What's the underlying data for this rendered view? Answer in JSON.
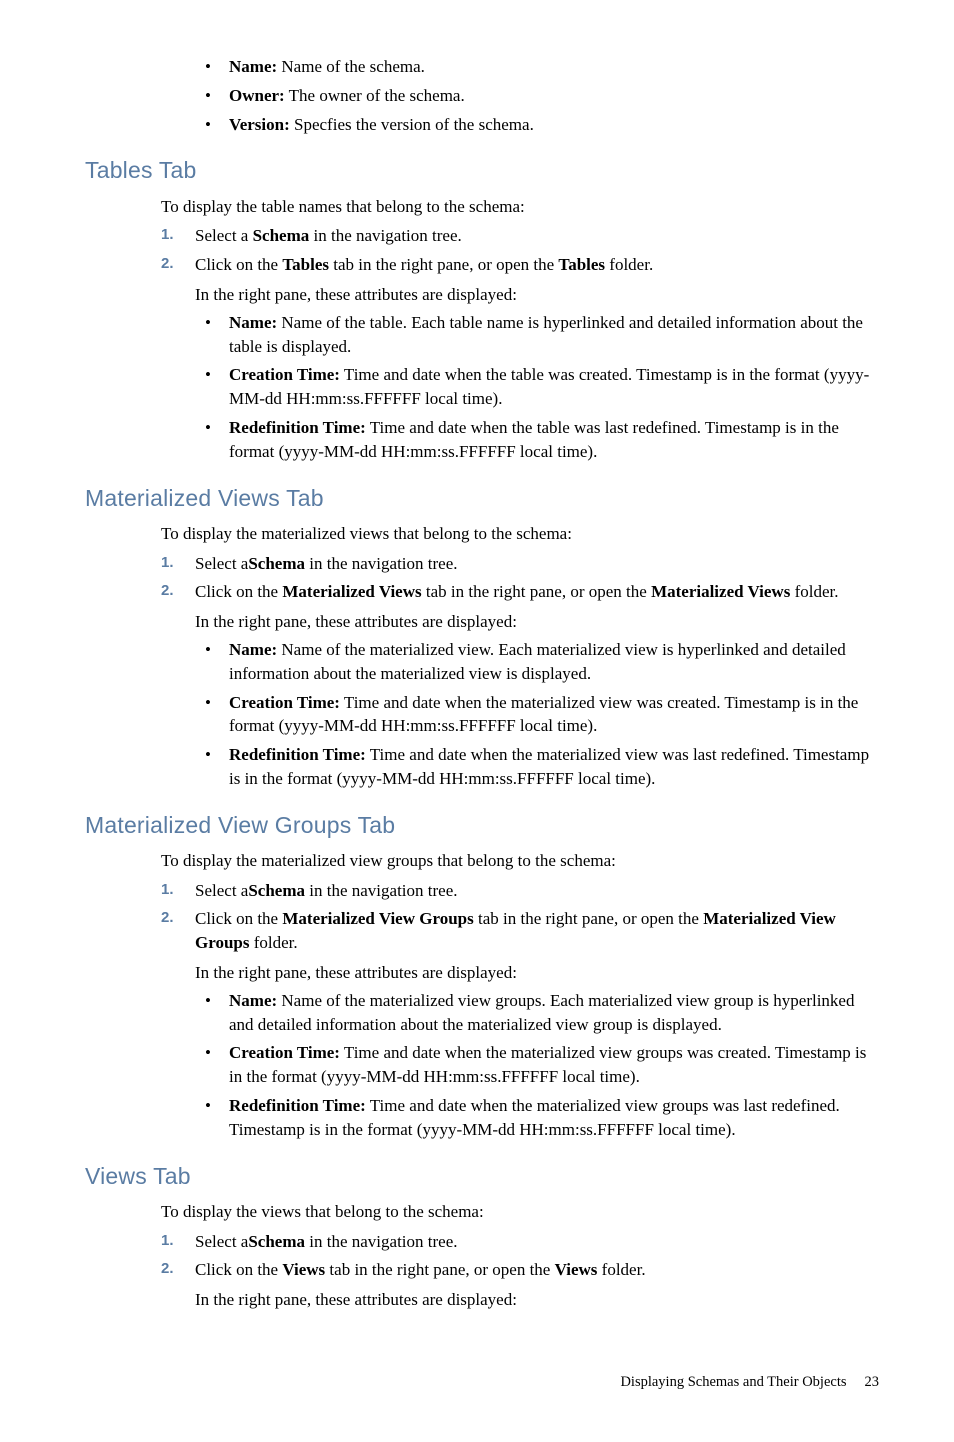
{
  "intro_bullets": [
    {
      "term": "Name:",
      "desc": " Name of the schema."
    },
    {
      "term": "Owner:",
      "desc": " The owner of the schema."
    },
    {
      "term": "Version:",
      "desc": " Specfies the version of the schema."
    }
  ],
  "sections": {
    "tables": {
      "heading": "Tables Tab",
      "intro": "To display the table names that belong to the schema:",
      "step1_pre": "Select a ",
      "step1_b": "Schema",
      "step1_post": " in the navigation tree.",
      "step2_pre": "Click on the ",
      "step2_b1": "Tables",
      "step2_mid": " tab in the right pane, or open the ",
      "step2_b2": "Tables",
      "step2_post": " folder.",
      "attrline": "In the right pane, these attributes are displayed:",
      "attrs": [
        {
          "term": "Name:",
          "desc": " Name of the table. Each table name is hyperlinked and detailed information about the table is displayed."
        },
        {
          "term": "Creation Time:",
          "desc": " Time and date when the table was created. Timestamp is in the format (yyyy-MM-dd HH:mm:ss.FFFFFF local time)."
        },
        {
          "term": "Redefinition Time:",
          "desc": " Time and date when the table was last redefined. Timestamp is in the format (yyyy-MM-dd HH:mm:ss.FFFFFF local time)."
        }
      ]
    },
    "mviews": {
      "heading": "Materialized Views Tab",
      "intro": "To display the materialized views that belong to the schema:",
      "step1_pre": "Select a",
      "step1_b": "Schema",
      "step1_post": " in the navigation tree.",
      "step2_pre": "Click on the ",
      "step2_b1": "Materialized Views",
      "step2_mid": " tab in the right pane, or open the ",
      "step2_b2": "Materialized Views",
      "step2_post": " folder.",
      "attrline": "In the right pane, these attributes are displayed:",
      "attrs": [
        {
          "term": "Name:",
          "desc": " Name of the materialized view. Each materialized view is hyperlinked and detailed information about the materialized view is displayed."
        },
        {
          "term": "Creation Time:",
          "desc": " Time and date when the materialized view was created. Timestamp is in the format (yyyy-MM-dd HH:mm:ss.FFFFFF local time)."
        },
        {
          "term": "Redefinition Time:",
          "desc": " Time and date when the materialized view was last redefined. Timestamp is in the format (yyyy-MM-dd HH:mm:ss.FFFFFF local time)."
        }
      ]
    },
    "mvgroups": {
      "heading": "Materialized View Groups Tab",
      "intro": "To display the materialized view groups that belong to the schema:",
      "step1_pre": "Select a",
      "step1_b": "Schema",
      "step1_post": " in the navigation tree.",
      "step2_pre": "Click on the ",
      "step2_b1": "Materialized View Groups",
      "step2_mid": " tab in the right pane, or open the ",
      "step2_b2": "Materialized View Groups",
      "step2_post": " folder.",
      "attrline": "In the right pane, these attributes are displayed:",
      "attrs": [
        {
          "term": "Name:",
          "desc": " Name of the materialized view groups. Each materialized view group is hyperlinked and detailed information about the materialized view group is displayed."
        },
        {
          "term": "Creation Time:",
          "desc": " Time and date when the materialized view groups was created. Timestamp is in the format (yyyy-MM-dd HH:mm:ss.FFFFFF local time)."
        },
        {
          "term": "Redefinition Time:",
          "desc": " Time and date when the materialized view groups was last redefined. Timestamp is in the format (yyyy-MM-dd HH:mm:ss.FFFFFF local time)."
        }
      ]
    },
    "views": {
      "heading": "Views Tab",
      "intro": "To display the views that belong to the schema:",
      "step1_pre": "Select a",
      "step1_b": "Schema",
      "step1_post": " in the navigation tree.",
      "step2_pre": "Click on the ",
      "step2_b1": "Views",
      "step2_mid": " tab in the right pane, or open the ",
      "step2_b2": "Views",
      "step2_post": " folder.",
      "attrline": "In the right pane, these attributes are displayed:"
    }
  },
  "nums": {
    "one": "1.",
    "two": "2."
  },
  "footer": {
    "text": "Displaying Schemas and Their Objects",
    "page": "23"
  }
}
